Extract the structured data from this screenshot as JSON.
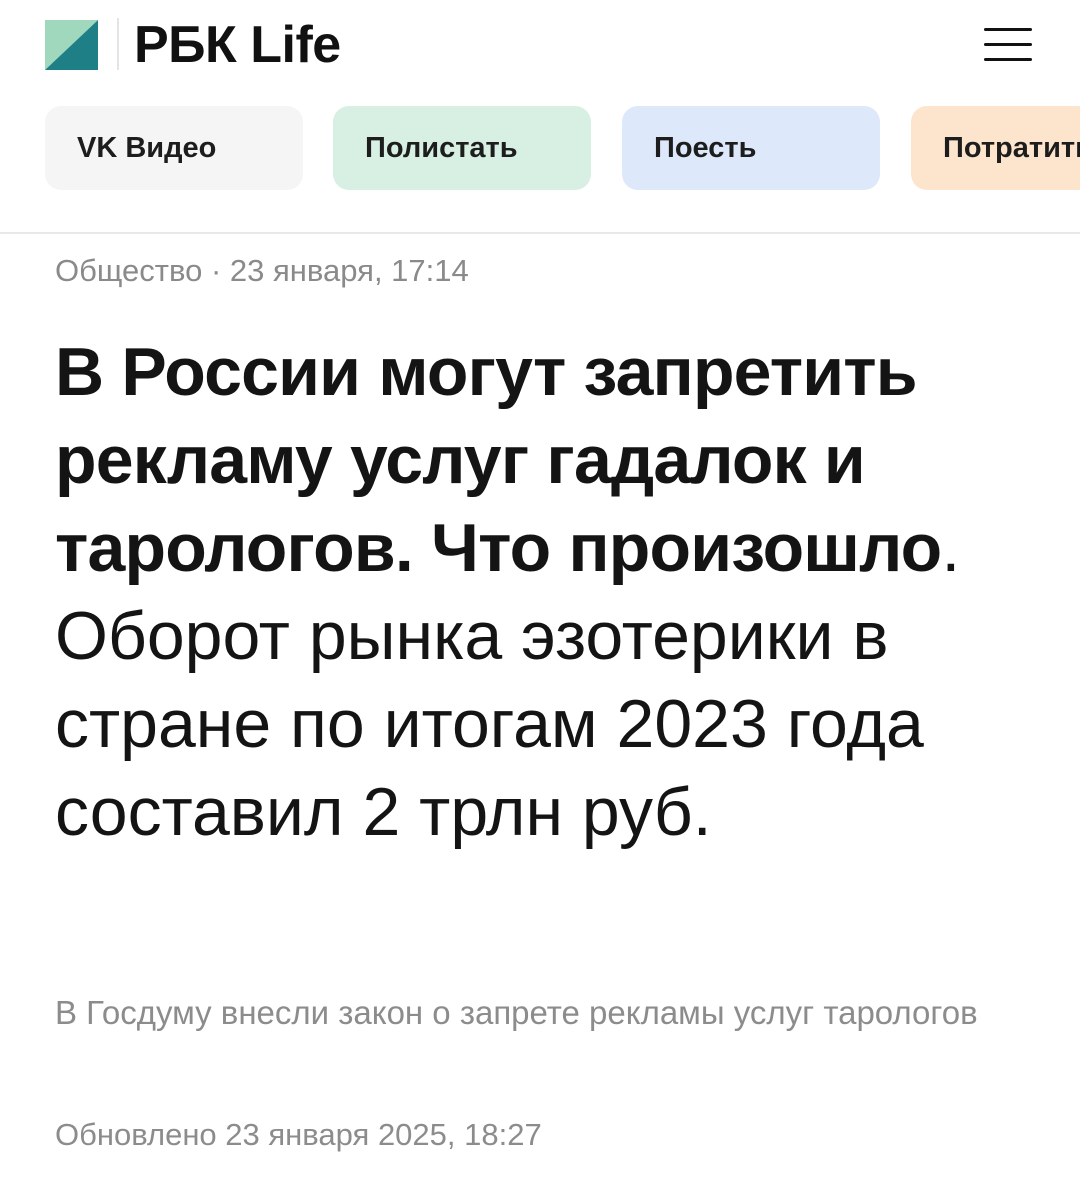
{
  "header": {
    "logo_text": "РБК Life",
    "logo_colors": {
      "top_left": "#9fd8bd",
      "bottom_right": "#1f7f86"
    }
  },
  "chips": [
    {
      "label": "VK Видео",
      "color": "#f5f5f5"
    },
    {
      "label": "Полистать",
      "color": "#d8f0e4"
    },
    {
      "label": "Поесть",
      "color": "#dde9fb"
    },
    {
      "label": "Потратить",
      "color": "#fde4cc"
    }
  ],
  "article": {
    "category": "Общество",
    "meta_separator": "·",
    "date": "23 января, 17:14",
    "headline_bold": "В России могут запретить рекламу услуг гадалок и тарологов. Что произошло",
    "headline_dot": ".",
    "headline_rest": " Оборот рынка эзотерики в стране по итогам 2023 года составил 2 трлн руб.",
    "subtitle": "В Госдуму внесли закон о запрете рекламы услуг тарологов",
    "updated": "Обновлено 23 января 2025, 18:27"
  }
}
